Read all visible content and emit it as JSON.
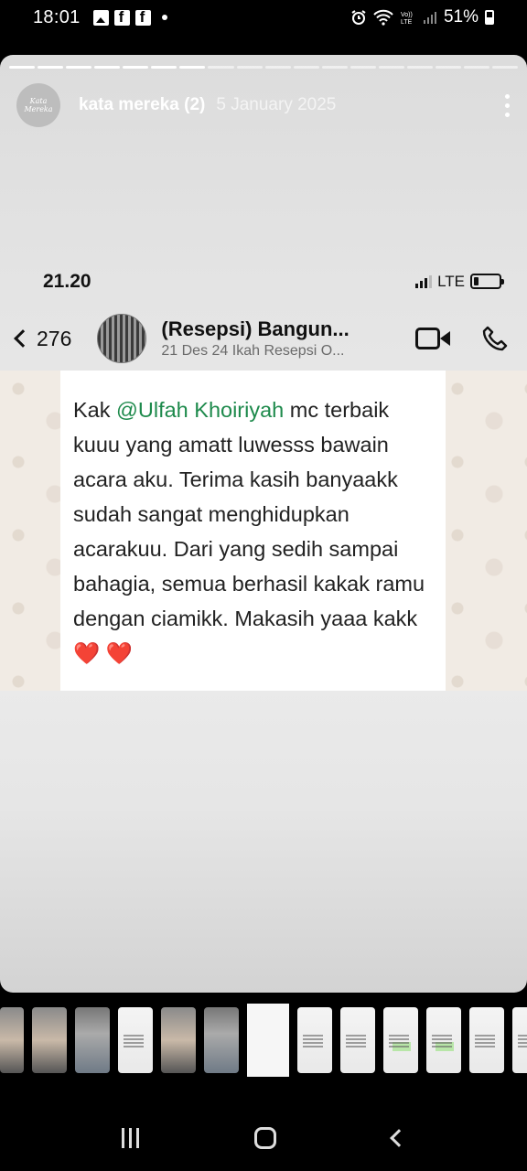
{
  "system_status": {
    "time": "18:01",
    "notification_icons": [
      "gallery-icon",
      "facebook-icon",
      "facebook-icon",
      "dot-icon"
    ],
    "right_icons": [
      "alarm-icon",
      "wifi-icon",
      "volte-icon",
      "signal-icon"
    ],
    "battery": "51%"
  },
  "story": {
    "avatar_text": "Kata Mereka",
    "account_name": "kata mereka (2)",
    "date": "5 January 2025",
    "segments_total": 18,
    "segments_done": 7
  },
  "whatsapp": {
    "status_time": "21.20",
    "network": "LTE",
    "back_count": "276",
    "group_name": "(Resepsi) Bangun...",
    "group_subtitle": "21 Des 24 Ikah Resepsi O...",
    "message": {
      "prefix": "Kak ",
      "mention": "@Ulfah Khoiriyah",
      "body": " mc terbaik kuuu yang amatt luwesss bawain acara aku. Terima kasih banyaakk sudah sangat menghidupkan acarakuu. Dari yang sedih sampai bahagia, semua berhasil kakak ramu dengan ciamikk. Makasih yaaa kakk",
      "hearts": "❤️ ❤️"
    }
  },
  "thumbnails": [
    "photo",
    "photo",
    "photo2",
    "chat",
    "photo",
    "photo2",
    "active",
    "chat",
    "chat",
    "green",
    "green",
    "chat",
    "chat"
  ],
  "nav": [
    "recents-button",
    "home-button",
    "back-button"
  ]
}
